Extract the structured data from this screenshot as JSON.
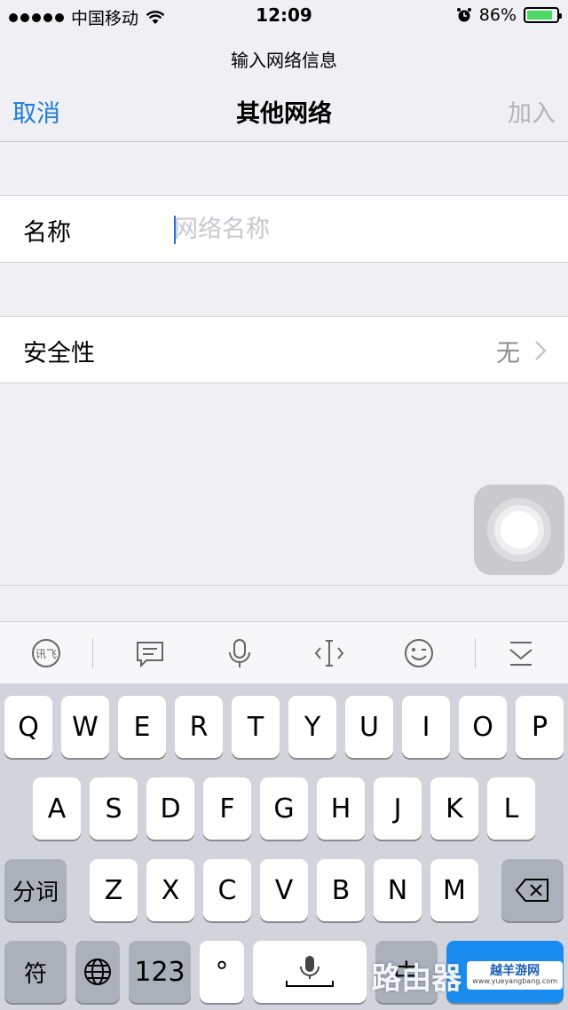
{
  "status_bar": {
    "carrier": "中国移动",
    "time": "12:09",
    "battery": "86%",
    "battery_level": 0.86
  },
  "nav": {
    "subtitle": "输入网络信息",
    "cancel": "取消",
    "title": "其他网络",
    "join": "加入"
  },
  "form": {
    "name_label": "名称",
    "name_placeholder": "网络名称",
    "name_value": "",
    "security_label": "安全性",
    "security_value": "无"
  },
  "keyboard": {
    "row1": [
      "Q",
      "W",
      "E",
      "R",
      "T",
      "Y",
      "U",
      "I",
      "O",
      "P"
    ],
    "row2": [
      "A",
      "S",
      "D",
      "F",
      "G",
      "H",
      "J",
      "K",
      "L"
    ],
    "row3": [
      "Z",
      "X",
      "C",
      "V",
      "B",
      "N",
      "M"
    ],
    "segment_label": "分词",
    "symbol_label": "符",
    "numbers_label": "123",
    "punct_label": "°",
    "lang_label": "中",
    "toolbar_icons": [
      "xunfei-icon",
      "message-icon",
      "microphone-icon",
      "cursor-icon",
      "emoji-icon",
      "hide-keyboard-icon"
    ]
  },
  "watermark": {
    "text": "路由器",
    "badge": "越羊游网",
    "badge_sub": "www.yueyangbang.com"
  },
  "colors": {
    "accent": "#1f7dd6",
    "background": "#efeff4",
    "battery": "#4cd964"
  }
}
